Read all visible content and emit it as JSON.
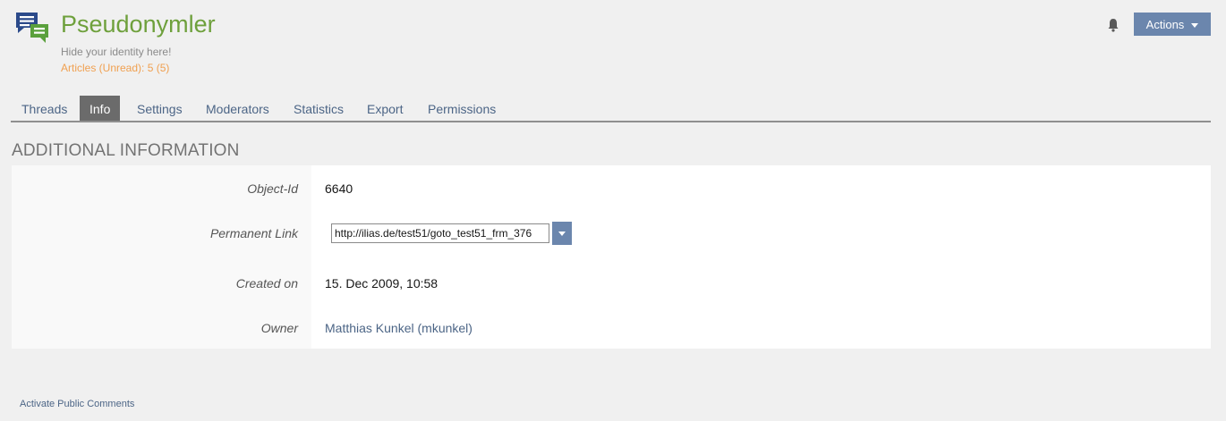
{
  "header": {
    "title": "Pseudonymler",
    "subtitle": "Hide your identity here!",
    "unread": "Articles (Unread): 5 (5)",
    "actions_label": "Actions",
    "icon": "forum-icon",
    "bell_icon": "bell-icon"
  },
  "tabs": [
    {
      "label": "Threads",
      "active": false
    },
    {
      "label": "Info",
      "active": true
    },
    {
      "label": "Settings",
      "active": false
    },
    {
      "label": "Moderators",
      "active": false
    },
    {
      "label": "Statistics",
      "active": false
    },
    {
      "label": "Export",
      "active": false
    },
    {
      "label": "Permissions",
      "active": false
    }
  ],
  "info": {
    "section_title": "ADDITIONAL INFORMATION",
    "object_id_label": "Object-Id",
    "object_id_value": "6640",
    "permalink_label": "Permanent Link",
    "permalink_value": "http://ilias.de/test51/goto_test51_frm_376",
    "created_label": "Created on",
    "created_value": "15. Dec 2009, 10:58",
    "owner_label": "Owner",
    "owner_value": "Matthias Kunkel (mkunkel)"
  },
  "footer": {
    "activate_comments": "Activate Public Comments"
  },
  "colors": {
    "title": "#6ea03c",
    "unread": "#f0a050",
    "accent": "#6b86ad",
    "link": "#4c6586",
    "active_tab": "#6b6b6b"
  }
}
